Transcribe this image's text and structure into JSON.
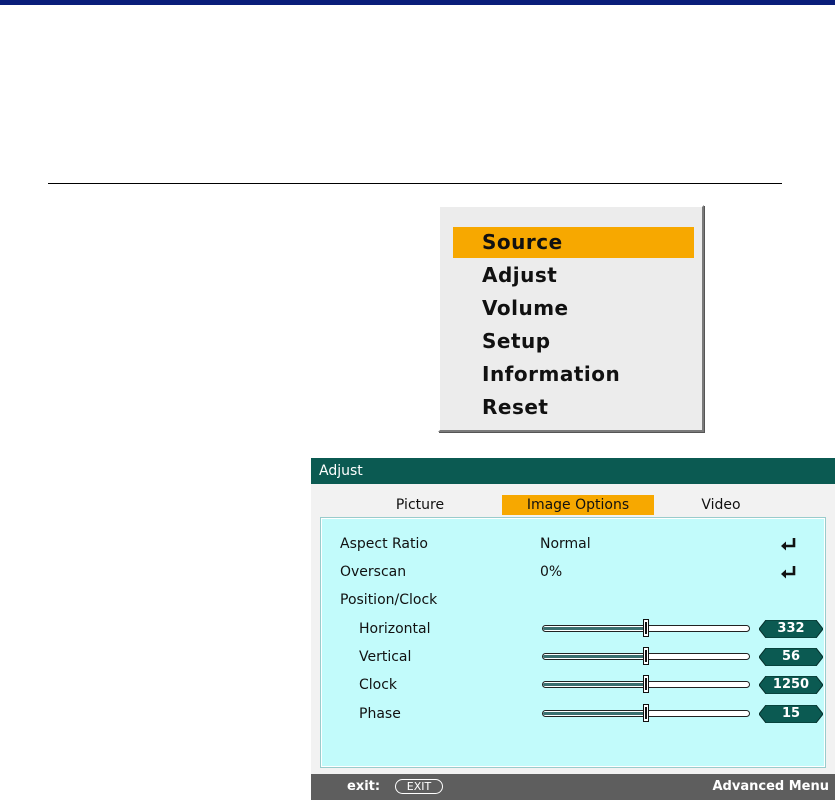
{
  "main_menu": {
    "items": [
      {
        "label": "Source",
        "selected": true
      },
      {
        "label": "Adjust",
        "selected": false
      },
      {
        "label": "Volume",
        "selected": false
      },
      {
        "label": "Setup",
        "selected": false
      },
      {
        "label": "Information",
        "selected": false
      },
      {
        "label": "Reset",
        "selected": false
      }
    ]
  },
  "adjust": {
    "title": "Adjust",
    "tabs": [
      {
        "label": "Picture",
        "active": false
      },
      {
        "label": "Image Options",
        "active": true
      },
      {
        "label": "Video",
        "active": false
      }
    ],
    "aspect_ratio": {
      "label": "Aspect Ratio",
      "value": "Normal"
    },
    "overscan": {
      "label": "Overscan",
      "value": "0%"
    },
    "position_clock": {
      "label": "Position/Clock"
    },
    "sliders": [
      {
        "label": "Horizontal",
        "value": "332",
        "fraction": 0.5
      },
      {
        "label": "Vertical",
        "value": "56",
        "fraction": 0.5
      },
      {
        "label": "Clock",
        "value": "1250",
        "fraction": 0.5
      },
      {
        "label": "Phase",
        "value": "15",
        "fraction": 0.5
      }
    ],
    "footer": {
      "exit_label": "exit:",
      "exit_button": "EXIT",
      "advanced_menu": "Advanced Menu"
    }
  },
  "colors": {
    "accent": "#f7a800",
    "title_bar": "#0b5a52",
    "panel": "#c2fbfb",
    "top_bar": "#0a1e7a",
    "value_tag": "#0b5a52"
  },
  "icons": {
    "enter": "enter-return-icon"
  }
}
